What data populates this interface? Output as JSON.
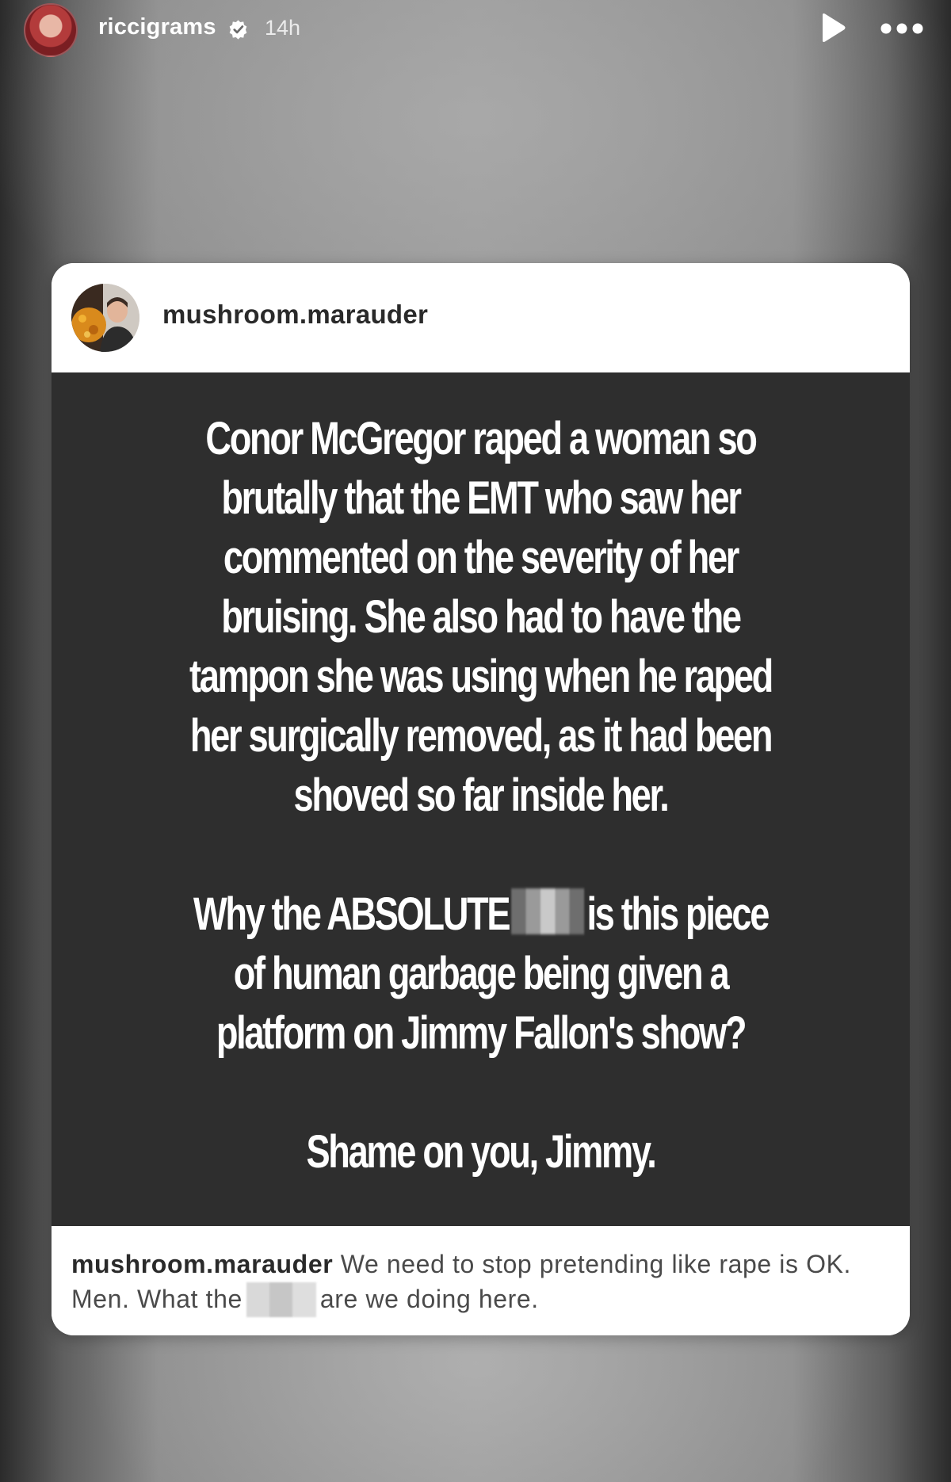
{
  "story": {
    "username": "riccigrams",
    "verified": true,
    "time_ago": "14h",
    "icons": {
      "avatar": "profile-avatar",
      "verified": "verified-badge-icon",
      "play": "play-icon",
      "more": "more-options-icon"
    }
  },
  "shared_post": {
    "username": "mushroom.marauder",
    "text": {
      "paragraph1": "Conor McGregor raped a woman so brutally that the EMT who saw her commented on the severity of her bruising. She also had to have the tampon she was using when he raped her surgically removed, as it had been shoved so far inside her.",
      "paragraph2_before": "Why the ABSOLUTE",
      "paragraph2_after": "is this piece of human garbage being given a platform on Jimmy Fallon's show?",
      "paragraph3": "Shame on you, Jimmy."
    },
    "caption": {
      "username": "mushroom.marauder",
      "text_before": "We need to stop pretending like rape is OK. Men. What the",
      "text_after": "are we doing here."
    }
  },
  "colors": {
    "card_body": "#2e2e2e",
    "card_text": "#ffffff",
    "caption_text": "#4a4a4a"
  }
}
